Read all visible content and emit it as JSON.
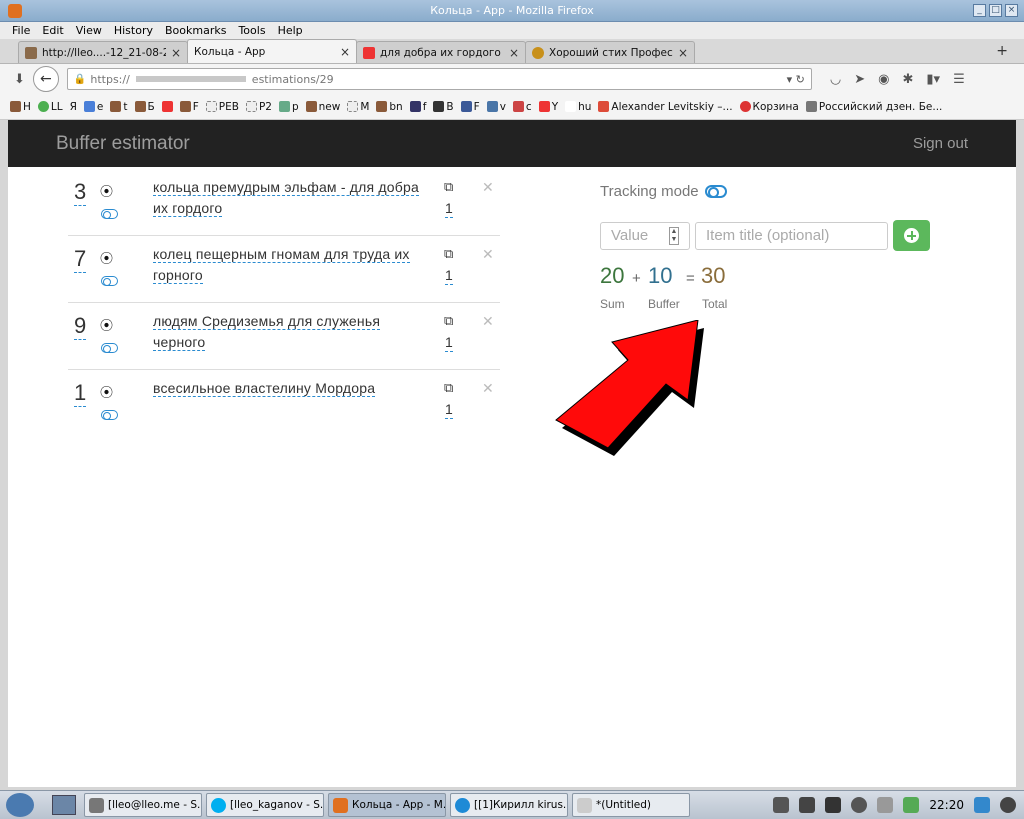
{
  "window": {
    "title": "Кольца - App - Mozilla Firefox"
  },
  "menu": [
    "File",
    "Edit",
    "View",
    "History",
    "Bookmarks",
    "Tools",
    "Help"
  ],
  "tabs": [
    {
      "label": "http://lleo....-12_21-08-28",
      "active": false
    },
    {
      "label": "Кольца - App",
      "active": true
    },
    {
      "label": "для добра их гордого — ...",
      "active": false
    },
    {
      "label": "Хороший стих Професс...",
      "active": false
    }
  ],
  "url": {
    "prefix": "https://",
    "suffix": "estimations/29"
  },
  "bookmarks": [
    "H",
    "LL",
    "Я",
    "e",
    "t",
    "Б",
    "F",
    "PEB",
    "P2",
    "p",
    "new",
    "M",
    "bn",
    "f",
    "B",
    "F",
    "v",
    "c",
    "Y",
    "hu",
    "Alexander Levitskiy –...",
    "Корзина",
    "Российский дзен. Бе..."
  ],
  "app": {
    "brand": "Buffer estimator",
    "signout": "Sign out"
  },
  "items": [
    {
      "num": "3",
      "title": "кольца премудрым эльфам - для добра их гордого",
      "qty": "1"
    },
    {
      "num": "7",
      "title": "колец пещерным гномам для труда их горного",
      "qty": "1"
    },
    {
      "num": "9",
      "title": "людям Средиземья для служенья черного",
      "qty": "1"
    },
    {
      "num": "1",
      "title": "всесильное властелину Мордора",
      "qty": "1"
    }
  ],
  "tracking": {
    "label": "Tracking mode"
  },
  "form": {
    "value_placeholder": "Value",
    "title_placeholder": "Item title (optional)"
  },
  "totals": {
    "sum": "20",
    "sum_label": "Sum",
    "plus": "+",
    "buffer": "10",
    "buffer_label": "Buffer",
    "equals": "=",
    "total": "30",
    "total_label": "Total",
    "colors": {
      "sum": "#3c763d",
      "buffer": "#31708f",
      "total": "#8a6d3b"
    }
  },
  "taskbar": {
    "tasks": [
      "[lleo@lleo.me - S...",
      "[lleo_kaganov - S...",
      "Кольца - App - M...",
      "[[1]Кирилл kirus...",
      "*(Untitled)"
    ],
    "clock": "22:20"
  }
}
